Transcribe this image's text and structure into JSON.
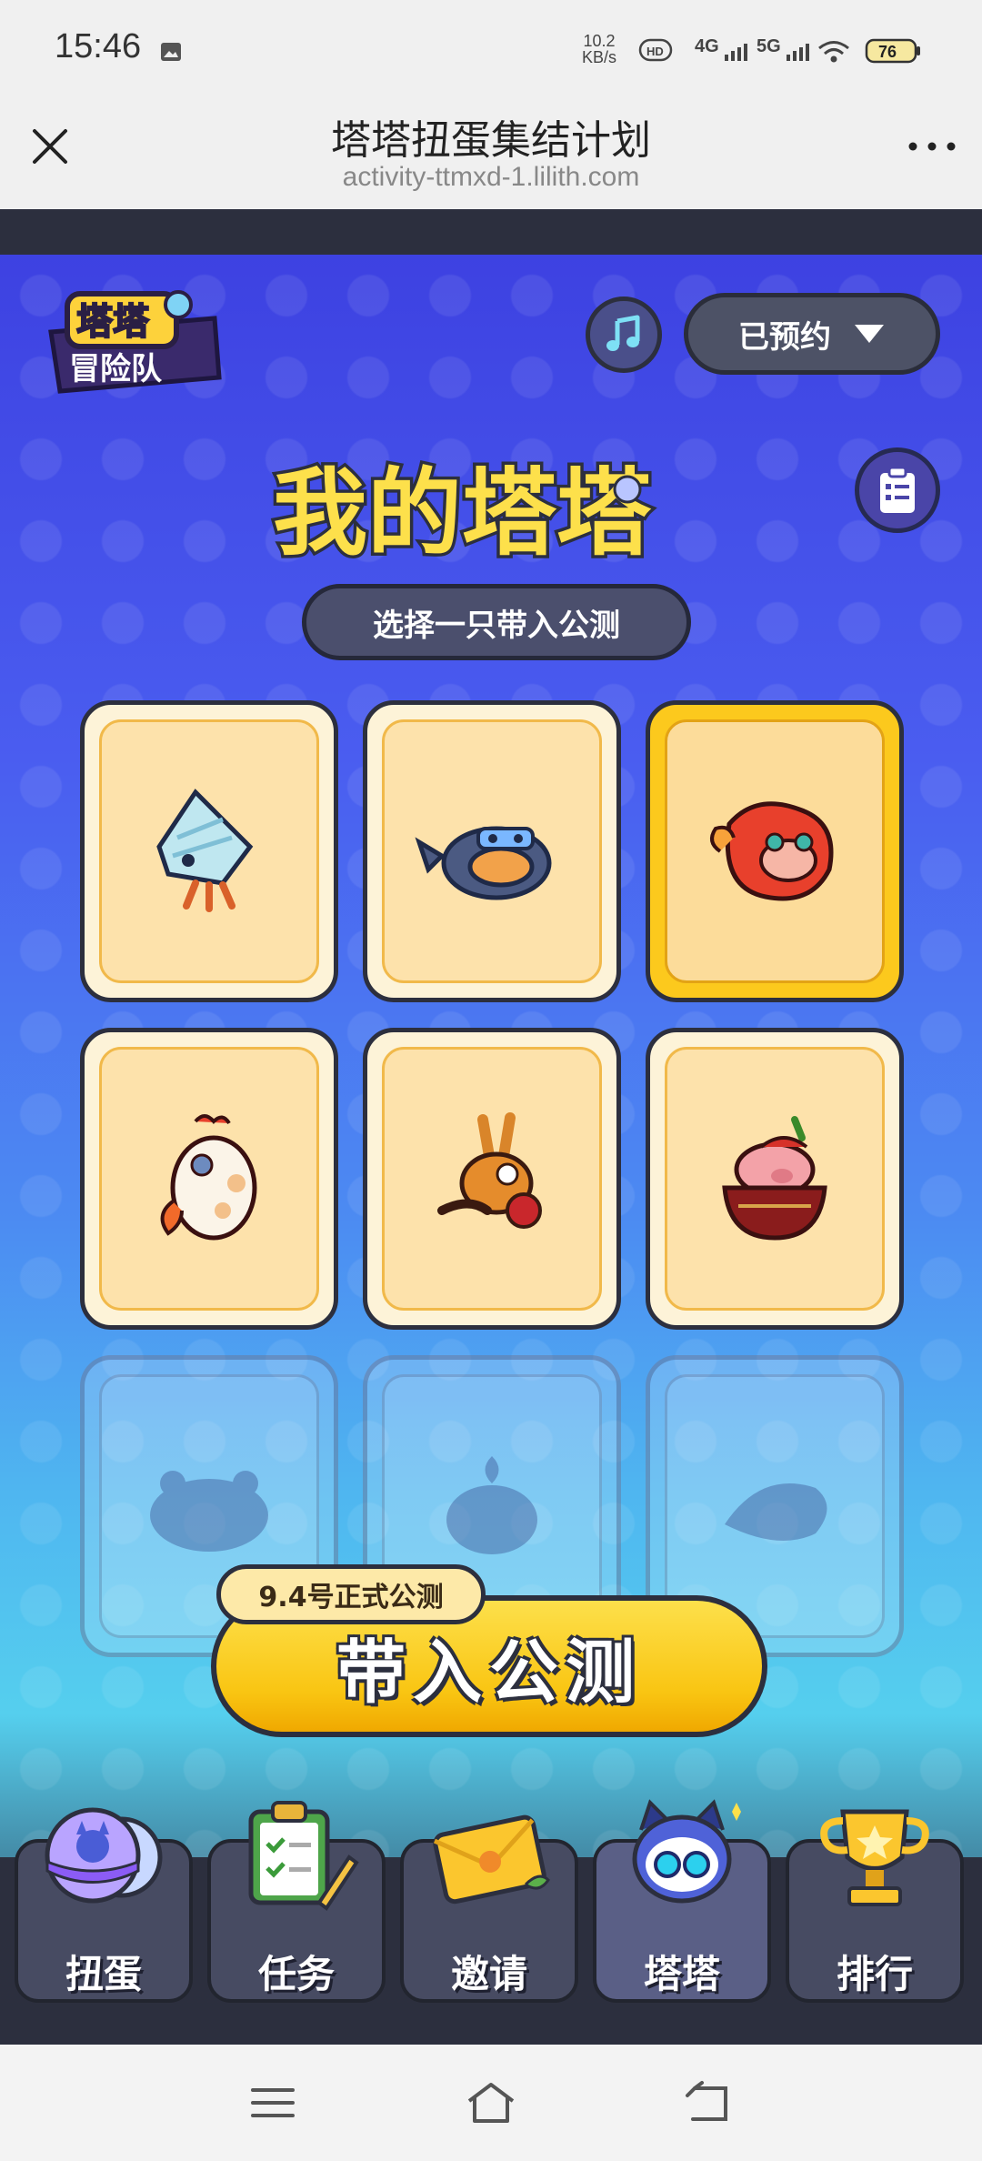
{
  "status_bar": {
    "time": "15:46",
    "net_speed_value": "10.2",
    "net_speed_unit": "KB/s",
    "signal_1": "4G",
    "signal_2": "5G",
    "battery": "76"
  },
  "browser": {
    "title": "塔塔扭蛋集结计划",
    "url": "activity-ttmxd-1.lilith.com"
  },
  "header": {
    "reserve_label": "已预约"
  },
  "page": {
    "title": "我的塔塔",
    "subtitle": "选择一只带入公测"
  },
  "pets": [
    {
      "icon": "hermit-crab-icon",
      "state": "unlocked"
    },
    {
      "icon": "platypus-icon",
      "state": "unlocked"
    },
    {
      "icon": "red-axolotl-icon",
      "state": "selected"
    },
    {
      "icon": "chick-icon",
      "state": "unlocked"
    },
    {
      "icon": "kangaroo-icon",
      "state": "unlocked"
    },
    {
      "icon": "pig-bowl-icon",
      "state": "unlocked"
    },
    {
      "icon": "hamster-icon",
      "state": "locked"
    },
    {
      "icon": "sprout-bird-icon",
      "state": "locked"
    },
    {
      "icon": "lizard-icon",
      "state": "locked"
    }
  ],
  "launch": {
    "date_tag": "9.4号正式公测",
    "button": "带入公测"
  },
  "nav": [
    {
      "label": "扭蛋",
      "icon": "gacha-capsule-icon"
    },
    {
      "label": "任务",
      "icon": "task-clipboard-icon"
    },
    {
      "label": "邀请",
      "icon": "invite-envelope-icon"
    },
    {
      "label": "塔塔",
      "icon": "tata-robot-icon"
    },
    {
      "label": "排行",
      "icon": "trophy-icon"
    }
  ],
  "colors": {
    "selected_card": "#fcc91d",
    "card_bg": "#fde2ab",
    "launch_button": "#f9c512",
    "dark_outline": "#2c2f3e"
  }
}
